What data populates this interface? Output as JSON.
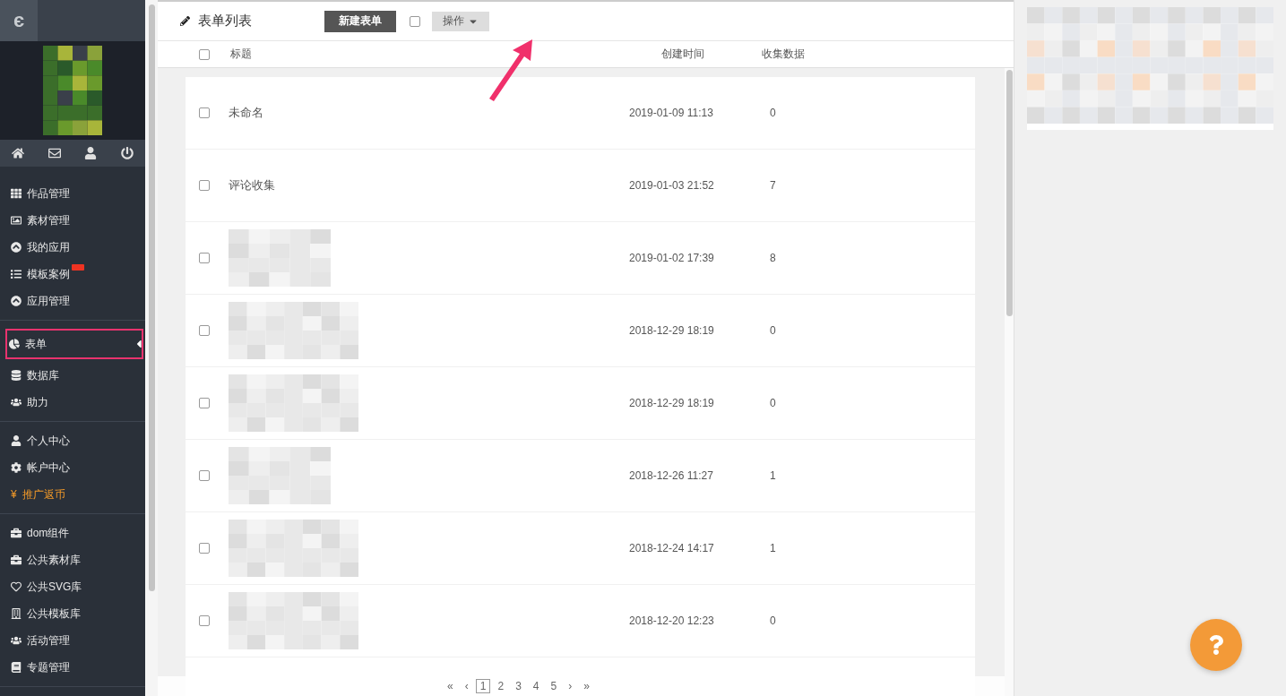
{
  "sidebar": {
    "logo": "є",
    "groups": [
      [
        {
          "kind": "link",
          "label": "作品管理",
          "selected": false,
          "badge": false
        },
        {
          "kind": "link",
          "label": "素材管理",
          "selected": false,
          "badge": false
        },
        {
          "kind": "link",
          "label": "我的应用",
          "selected": false,
          "badge": false
        },
        {
          "kind": "link",
          "label": "模板案例",
          "selected": false,
          "badge": true
        },
        {
          "kind": "link",
          "label": "应用管理",
          "selected": false,
          "badge": false
        }
      ],
      [
        {
          "kind": "link",
          "label": "表单",
          "selected": true,
          "badge": false
        },
        {
          "kind": "link",
          "label": "数据库",
          "selected": false,
          "badge": false
        },
        {
          "kind": "link",
          "label": "助力",
          "selected": false,
          "badge": false
        }
      ],
      [
        {
          "kind": "link",
          "label": "个人中心",
          "selected": false,
          "badge": false
        },
        {
          "kind": "link",
          "label": "帐户中心",
          "selected": false,
          "badge": false
        },
        {
          "kind": "promo",
          "glyph": "¥",
          "label": "推广返币",
          "selected": false,
          "badge": false
        }
      ],
      [
        {
          "kind": "link",
          "label": "dom组件",
          "selected": false,
          "badge": false
        },
        {
          "kind": "link",
          "label": "公共素材库",
          "selected": false,
          "badge": false
        },
        {
          "kind": "link",
          "label": "公共SVG库",
          "selected": false,
          "badge": false
        },
        {
          "kind": "link",
          "label": "公共模板库",
          "selected": false,
          "badge": false
        },
        {
          "kind": "link",
          "label": "活动管理",
          "selected": false,
          "badge": false
        },
        {
          "kind": "link",
          "label": "专题管理",
          "selected": false,
          "badge": false
        }
      ]
    ]
  },
  "toolbar": {
    "title": "表单列表",
    "new_button": "新建表单",
    "select_all_checked": false,
    "actions_button": "操作"
  },
  "table": {
    "header_checked": false,
    "columns": [
      "标题",
      "创建时间",
      "收集数据"
    ],
    "rows": [
      {
        "kind": "text",
        "checked": false,
        "title": "未命名",
        "created": "2019-01-09 11:13",
        "count": "0"
      },
      {
        "kind": "text",
        "checked": false,
        "title": "评论收集",
        "created": "2019-01-03 21:52",
        "count": "7"
      },
      {
        "kind": "blurred",
        "checked": false,
        "created": "2019-01-02 17:39",
        "count": "8"
      },
      {
        "kind": "blurred",
        "checked": false,
        "created": "2018-12-29 18:19",
        "count": "0"
      },
      {
        "kind": "blurred",
        "checked": false,
        "created": "2018-12-29 18:19",
        "count": "0"
      },
      {
        "kind": "blurred",
        "checked": false,
        "created": "2018-12-26 11:27",
        "count": "1"
      },
      {
        "kind": "blurred",
        "checked": false,
        "created": "2018-12-24 14:17",
        "count": "1"
      },
      {
        "kind": "blurred",
        "checked": false,
        "created": "2018-12-20 12:23",
        "count": "0"
      }
    ]
  },
  "pagination": [
    {
      "label": "«",
      "selected": false
    },
    {
      "label": "‹",
      "selected": false
    },
    {
      "label": "1",
      "selected": true
    },
    {
      "label": "2",
      "selected": false
    },
    {
      "label": "3",
      "selected": false
    },
    {
      "label": "4",
      "selected": false
    },
    {
      "label": "5",
      "selected": false
    },
    {
      "label": "›",
      "selected": false
    },
    {
      "label": "»",
      "selected": false
    }
  ]
}
